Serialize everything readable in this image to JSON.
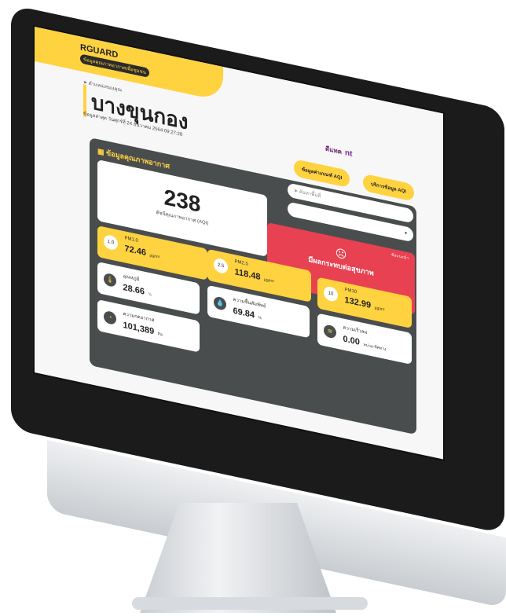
{
  "app": {
    "brand": "RGUARD",
    "brand_sub": "ข้อมูลคุณภาพอากาศเพื่อชุมชน"
  },
  "location": {
    "hint": "ตำแหน่งของคุณ",
    "name": "บางขุนกอง",
    "updated": "ข้อมูลล่าสุด วันศุกร์ที่ 24 ธันวาคม 2564 09:27:28"
  },
  "logos": {
    "left": "ดีแทค",
    "right": "nt"
  },
  "buttons": {
    "aqi_info": "ข้อมูลค่าเกณฑ์ AQI",
    "aqi_service": "บริการข้อมูล AQI"
  },
  "section": {
    "title": "ข้อมูลคุณภาพอากาศ",
    "search_placeholder": "ค้นหาพื้นที่",
    "dropdown_value": ""
  },
  "aqi": {
    "value": "238",
    "label": "ดัชนีคุณภาพอากาศ (AQI)"
  },
  "alert": {
    "text": "มีผลกระทบต่อสุขภาพ",
    "more": "ข้อแนะนำ"
  },
  "pm": [
    {
      "badge": "1.0",
      "label": "PM1.0",
      "value": "72.46",
      "unit": "µg/m³"
    },
    {
      "badge": "2.5",
      "label": "PM2.5",
      "value": "118.48",
      "unit": "µg/m³"
    },
    {
      "badge": "10",
      "label": "PM10",
      "value": "132.99",
      "unit": "µg/m³"
    }
  ],
  "weather": [
    {
      "icon": "thermometer-icon",
      "label": "อุณหภูมิ",
      "value": "28.66",
      "unit": "°c"
    },
    {
      "icon": "droplet-icon",
      "label": "ความชื้นสัมพัทธ์",
      "value": "69.84",
      "unit": "%"
    },
    {
      "icon": "wind-icon",
      "label": "ความเร็วลม",
      "value": "0.00",
      "unit": "หน่วย-ทิศทาง"
    },
    {
      "icon": "gauge-icon",
      "label": "ความกดอากาศ",
      "value": "101,389",
      "unit": "Pa"
    }
  ]
}
